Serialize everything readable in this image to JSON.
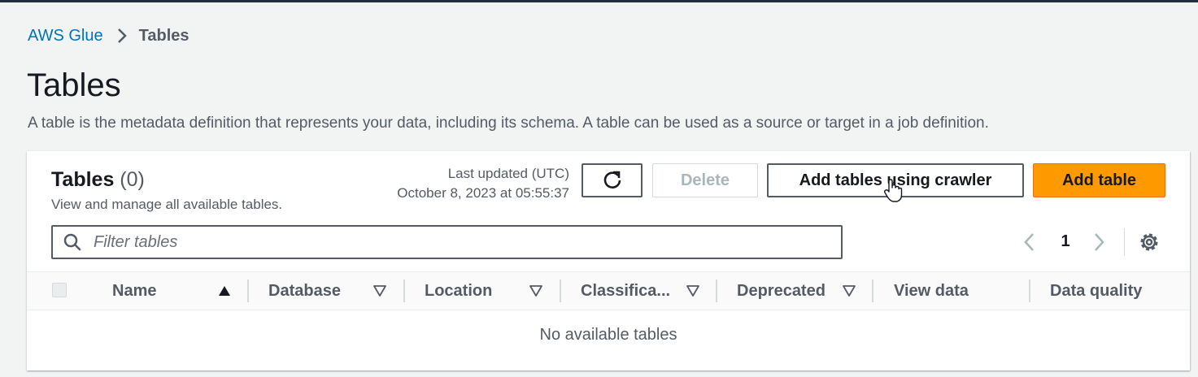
{
  "breadcrumb": {
    "root": "AWS Glue",
    "current": "Tables"
  },
  "page": {
    "title": "Tables",
    "description": "A table is the metadata definition that represents your data, including its schema. A table can be used as a source or target in a job definition."
  },
  "panel": {
    "title": "Tables",
    "count": "(0)",
    "subtitle": "View and manage all available tables.",
    "updated_label": "Last updated (UTC)",
    "updated_value": "October 8, 2023 at 05:55:37",
    "buttons": {
      "delete": "Delete",
      "add_crawler": "Add tables using crawler",
      "add_table": "Add table"
    },
    "filter": {
      "placeholder": "Filter tables",
      "value": ""
    },
    "pagination": {
      "current_page": "1"
    },
    "columns": [
      "Name",
      "Database",
      "Location",
      "Classifica...",
      "Deprecated",
      "View data",
      "Data quality"
    ],
    "empty_message": "No available tables"
  },
  "colors": {
    "accent": "#0073bb",
    "primary_button": "#ff9900",
    "text": "#16191f",
    "muted": "#545b64"
  },
  "icons": [
    "chevron-right-icon",
    "refresh-icon",
    "cursor-hand-icon",
    "search-icon",
    "chevron-left-icon",
    "gear-icon",
    "sort-ascending-icon",
    "sort-filter-icon"
  ]
}
